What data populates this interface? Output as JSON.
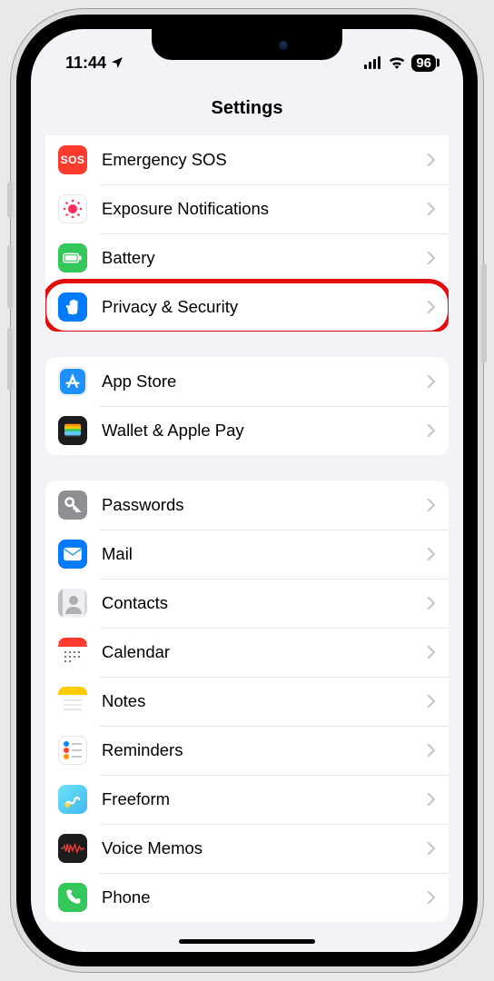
{
  "statusbar": {
    "time": "11:44",
    "battery": "96"
  },
  "header": {
    "title": "Settings"
  },
  "groups": [
    {
      "rows": [
        {
          "label": "Emergency SOS",
          "icon": "sos",
          "name": "settings-row-emergency-sos"
        },
        {
          "label": "Exposure Notifications",
          "icon": "exposure",
          "name": "settings-row-exposure-notifications"
        },
        {
          "label": "Battery",
          "icon": "battery",
          "name": "settings-row-battery"
        },
        {
          "label": "Privacy & Security",
          "icon": "privacy",
          "name": "settings-row-privacy-security",
          "highlighted": true
        }
      ]
    },
    {
      "rows": [
        {
          "label": "App Store",
          "icon": "appstore",
          "name": "settings-row-app-store"
        },
        {
          "label": "Wallet & Apple Pay",
          "icon": "wallet",
          "name": "settings-row-wallet-apple-pay"
        }
      ]
    },
    {
      "rows": [
        {
          "label": "Passwords",
          "icon": "passwords",
          "name": "settings-row-passwords"
        },
        {
          "label": "Mail",
          "icon": "mail",
          "name": "settings-row-mail"
        },
        {
          "label": "Contacts",
          "icon": "contacts",
          "name": "settings-row-contacts"
        },
        {
          "label": "Calendar",
          "icon": "calendar",
          "name": "settings-row-calendar"
        },
        {
          "label": "Notes",
          "icon": "notes",
          "name": "settings-row-notes"
        },
        {
          "label": "Reminders",
          "icon": "reminders",
          "name": "settings-row-reminders"
        },
        {
          "label": "Freeform",
          "icon": "freeform",
          "name": "settings-row-freeform"
        },
        {
          "label": "Voice Memos",
          "icon": "voice",
          "name": "settings-row-voice-memos"
        },
        {
          "label": "Phone",
          "icon": "phone",
          "name": "settings-row-phone"
        }
      ]
    }
  ]
}
